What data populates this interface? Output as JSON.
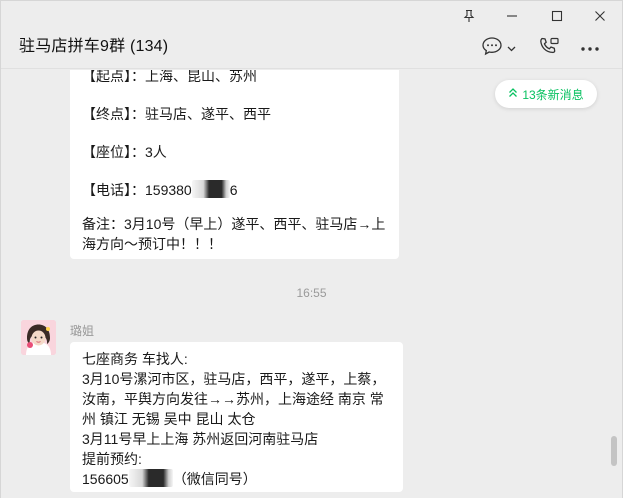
{
  "window": {
    "title": "驻马店拼车9群 (134)",
    "controls": [
      "pin-icon",
      "minimize-icon",
      "maximize-icon",
      "close-icon"
    ]
  },
  "header_actions": [
    "chat-bubble-icon",
    "chevron-down-icon",
    "phone-icon",
    "more-icon"
  ],
  "new_messages_badge": "13条新消息",
  "messages": [
    {
      "lines": [
        "【起点】：上海、昆山、苏州",
        "【终点】：驻马店、遂平、西平",
        "【座位】：3人",
        "【电话】：159380",
        "6",
        "备注：3月10号（早上）遂平、西平、驻马店→上",
        "海方向～预订中！！！"
      ]
    }
  ],
  "timestamp": "16:55",
  "message2": {
    "sender": "璐姐",
    "lines": [
      "七座商务 车找人:",
      "3月10号漯河市区，驻马店，西平，遂平，上蔡，",
      "汝南，平舆方向发往→→苏州，上海途经 南京 常",
      "州 镇江 无锡 吴中 昆山 太仓",
      "3月11号早上上海 苏州返回河南驻马店",
      "提前预约:",
      "156605",
      "（微信同号）"
    ]
  },
  "colors": {
    "background": "#ededed",
    "bubble": "#ffffff",
    "accent": "#07c160",
    "muted_text": "#9a9a9a"
  }
}
